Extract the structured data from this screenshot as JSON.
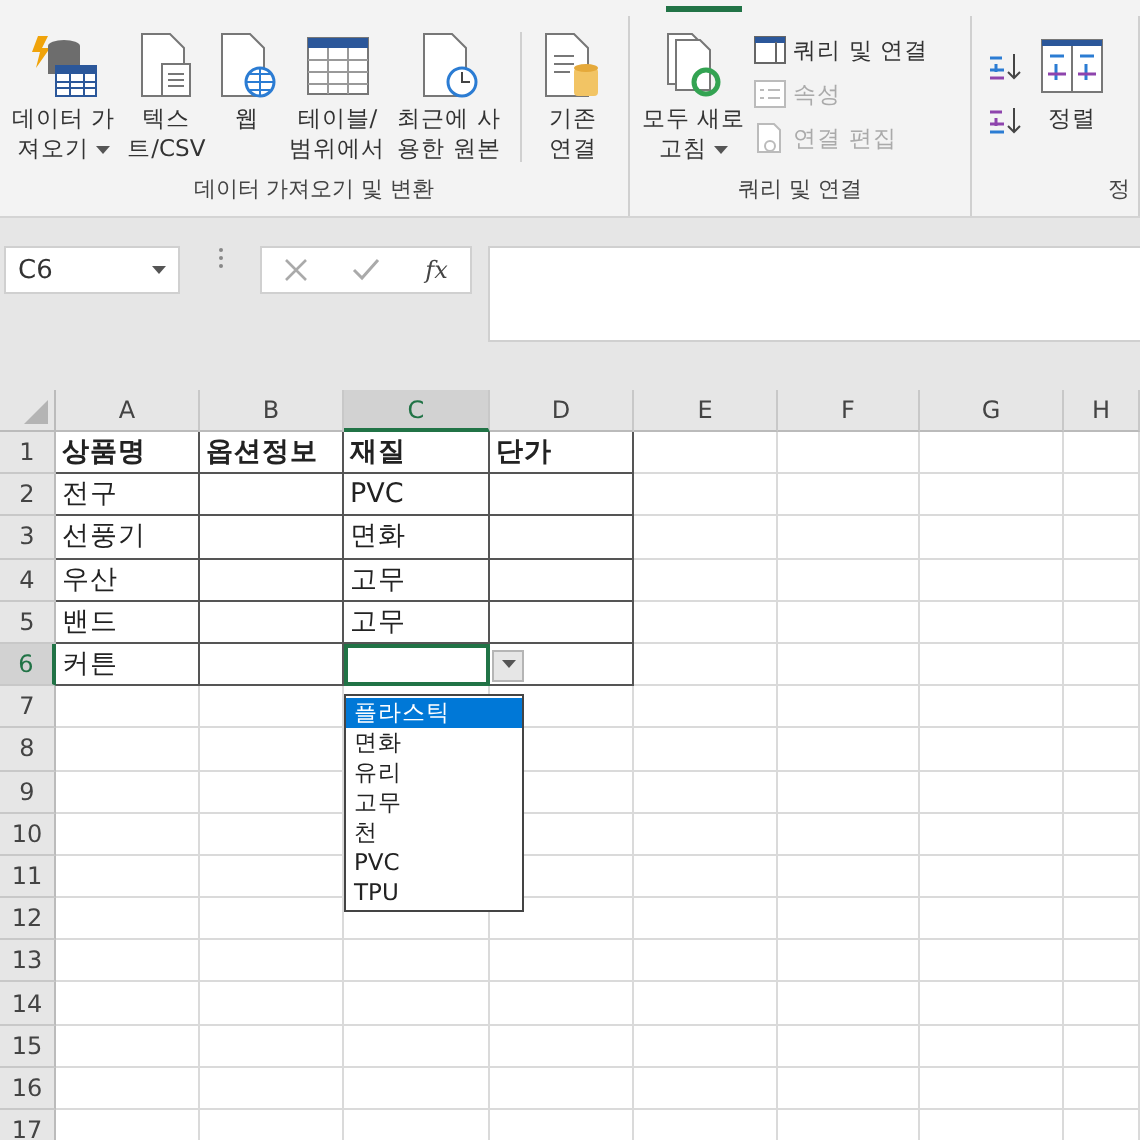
{
  "ribbon": {
    "groups": [
      {
        "label": "데이터 가져오기 및 변환",
        "buttons": [
          {
            "kind": "large",
            "label": "데이터 가\n져오기",
            "menu": true,
            "disabled": false
          },
          {
            "kind": "large",
            "label": "텍스\n트/CSV",
            "menu": false,
            "disabled": false
          },
          {
            "kind": "large",
            "label": "웹",
            "menu": false,
            "disabled": false
          },
          {
            "kind": "large",
            "label": "테이블/\n범위에서",
            "menu": false,
            "disabled": false
          },
          {
            "kind": "large",
            "label": "최근에 사\n용한 원본",
            "menu": false,
            "disabled": false
          },
          {
            "kind": "separator"
          },
          {
            "kind": "large",
            "label": "기존\n연결",
            "menu": false,
            "disabled": false
          }
        ]
      },
      {
        "label": "쿼리 및 연결",
        "buttons": [
          {
            "kind": "large",
            "label": "모두 새로\n고침",
            "menu": true,
            "disabled": false
          },
          {
            "kind": "stack",
            "items": [
              {
                "label": "쿼리 및 연결",
                "disabled": false
              },
              {
                "label": "속성",
                "disabled": true
              },
              {
                "label": "연결 편집",
                "disabled": true
              }
            ]
          }
        ]
      },
      {
        "label": "정",
        "buttons": [
          {
            "kind": "sort-pair"
          },
          {
            "kind": "large",
            "label": "정렬",
            "menu": false,
            "disabled": false
          }
        ]
      }
    ]
  },
  "formula_bar": {
    "name_box": "C6",
    "function_label": "fx"
  },
  "sheet": {
    "columns": [
      {
        "label": "A",
        "selected": false
      },
      {
        "label": "B",
        "selected": false
      },
      {
        "label": "C",
        "selected": true
      },
      {
        "label": "D",
        "selected": false
      },
      {
        "label": "E",
        "selected": false
      },
      {
        "label": "F",
        "selected": false
      },
      {
        "label": "G",
        "selected": false
      },
      {
        "label": "H",
        "selected": false
      }
    ],
    "rows": [
      {
        "number": "1",
        "selected": false,
        "cells": [
          "상품명",
          "옵션정보",
          "재질",
          "단가"
        ]
      },
      {
        "number": "2",
        "selected": false,
        "cells": [
          "전구",
          "",
          "PVC",
          ""
        ]
      },
      {
        "number": "3",
        "selected": false,
        "cells": [
          "선풍기",
          "",
          "면화",
          ""
        ]
      },
      {
        "number": "4",
        "selected": false,
        "cells": [
          "우산",
          "",
          "고무",
          ""
        ]
      },
      {
        "number": "5",
        "selected": false,
        "cells": [
          "밴드",
          "",
          "고무",
          ""
        ]
      },
      {
        "number": "6",
        "selected": true,
        "cells": [
          "커튼",
          "",
          "",
          ""
        ]
      },
      {
        "number": "7",
        "selected": false,
        "cells": []
      },
      {
        "number": "8",
        "selected": false,
        "cells": []
      },
      {
        "number": "9",
        "selected": false,
        "cells": []
      },
      {
        "number": "10",
        "selected": false,
        "cells": []
      },
      {
        "number": "11",
        "selected": false,
        "cells": []
      },
      {
        "number": "12",
        "selected": false,
        "cells": []
      },
      {
        "number": "13",
        "selected": false,
        "cells": []
      },
      {
        "number": "14",
        "selected": false,
        "cells": []
      },
      {
        "number": "15",
        "selected": false,
        "cells": []
      },
      {
        "number": "16",
        "selected": false,
        "cells": []
      },
      {
        "number": "17",
        "selected": false,
        "cells": []
      }
    ],
    "dropdown": {
      "options": [
        {
          "label": "플라스틱",
          "selected": true
        },
        {
          "label": "면화",
          "selected": false
        },
        {
          "label": "유리",
          "selected": false
        },
        {
          "label": "고무",
          "selected": false
        },
        {
          "label": "천",
          "selected": false
        },
        {
          "label": "PVC",
          "selected": false
        },
        {
          "label": "TPU",
          "selected": false
        }
      ]
    }
  }
}
